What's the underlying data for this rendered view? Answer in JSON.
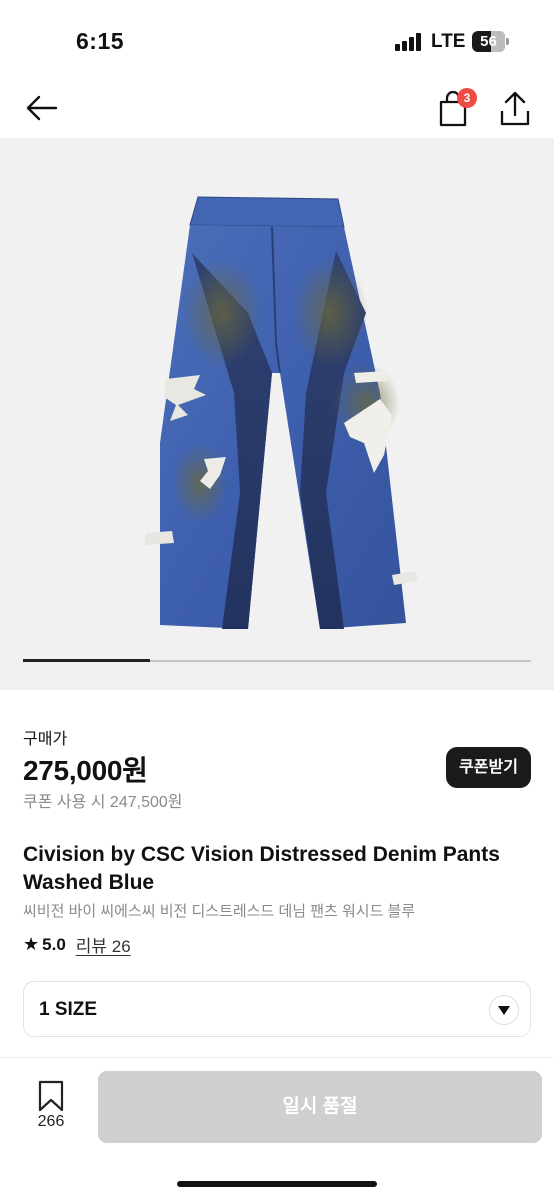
{
  "status_bar": {
    "time": "6:15",
    "network": "LTE",
    "battery": "56"
  },
  "nav": {
    "back_icon": "arrow-left-icon",
    "bag_icon": "shopping-bag-icon",
    "bag_badge": "3",
    "share_icon": "share-icon"
  },
  "gallery": {
    "image": "distressed-denim-pants-photo",
    "progress": 0.25
  },
  "price": {
    "label": "구매가",
    "amount": "275,000원",
    "coupon_price": "쿠폰 사용 시 247,500원",
    "coupon_button": "쿠폰받기"
  },
  "product": {
    "title_en": "Civision by CSC Vision Distressed Denim Pants Washed Blue",
    "title_kr": "씨비전 바이 씨에스씨 비전 디스트레스드 데님 팬츠 워시드 블루",
    "rating": "5.0",
    "reviews": "리뷰 26"
  },
  "size_select": {
    "value": "1 SIZE",
    "caret_icon": "chevron-down-icon"
  },
  "bottom": {
    "wish_icon": "bookmark-icon",
    "wish_count": "266",
    "buy_button": "일시 품절"
  },
  "colors": {
    "badge": "#ef4b45",
    "coupon_button": "#1b1b1b",
    "disabled_button": "#cfcfcf"
  }
}
